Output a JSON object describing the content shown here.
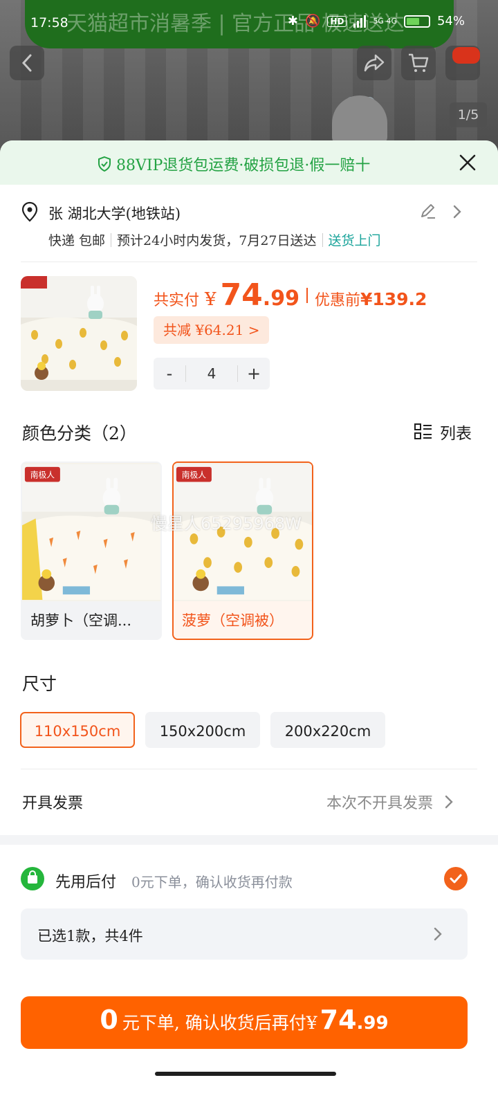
{
  "status_bar": {
    "time": "17:58",
    "network": "5G 4G",
    "battery": "54%"
  },
  "background": {
    "promo_banner": "天猫超市消暑季 | 官方正品 极速送达",
    "image_counter": "1/5"
  },
  "sheet": {
    "vip_text": "88VIP退货包运费·破损包退·假一赔十",
    "address": "张 湖北大学(地铁站)",
    "shipping": {
      "method": "快递 包邮",
      "estimate": "预计24小时内发货，7月27日送达",
      "door": "送货上门"
    },
    "product": {
      "price_label": "共实付",
      "currency": "¥",
      "price_int": "74",
      "price_dec": ".99",
      "orig_label": "优惠前",
      "orig_price": "¥139.2",
      "discount": "共减 ¥64.21 >",
      "quantity": "4",
      "minus": "-",
      "plus": "+"
    },
    "color_section": {
      "title": "颜色分类（2）",
      "list_toggle": "列表",
      "options": [
        {
          "name": "胡萝卜（空调...",
          "selected": false
        },
        {
          "name": "菠萝（空调被）",
          "selected": true
        }
      ],
      "watermark": "慢星人65295968W",
      "brand_tag": "南极人"
    },
    "size_section": {
      "title": "尺寸",
      "options": [
        {
          "label": "110x150cm",
          "selected": true
        },
        {
          "label": "150x200cm",
          "selected": false
        },
        {
          "label": "200x220cm",
          "selected": false
        }
      ]
    },
    "invoice": {
      "label": "开具发票",
      "value": "本次不开具发票"
    },
    "pay_later": {
      "title": "先用后付",
      "desc": "0元下单，确认收货再付款",
      "checked": true
    },
    "selected_summary": "已选1款，共4件",
    "cta": {
      "zero": "0",
      "text": "元下单, 确认收货后再付",
      "currency": "¥",
      "amount_int": "74",
      "amount_dec": ".99"
    }
  },
  "colors": {
    "accent": "#ff6200",
    "vip_green": "#23a243",
    "door_teal": "#19a39a"
  }
}
